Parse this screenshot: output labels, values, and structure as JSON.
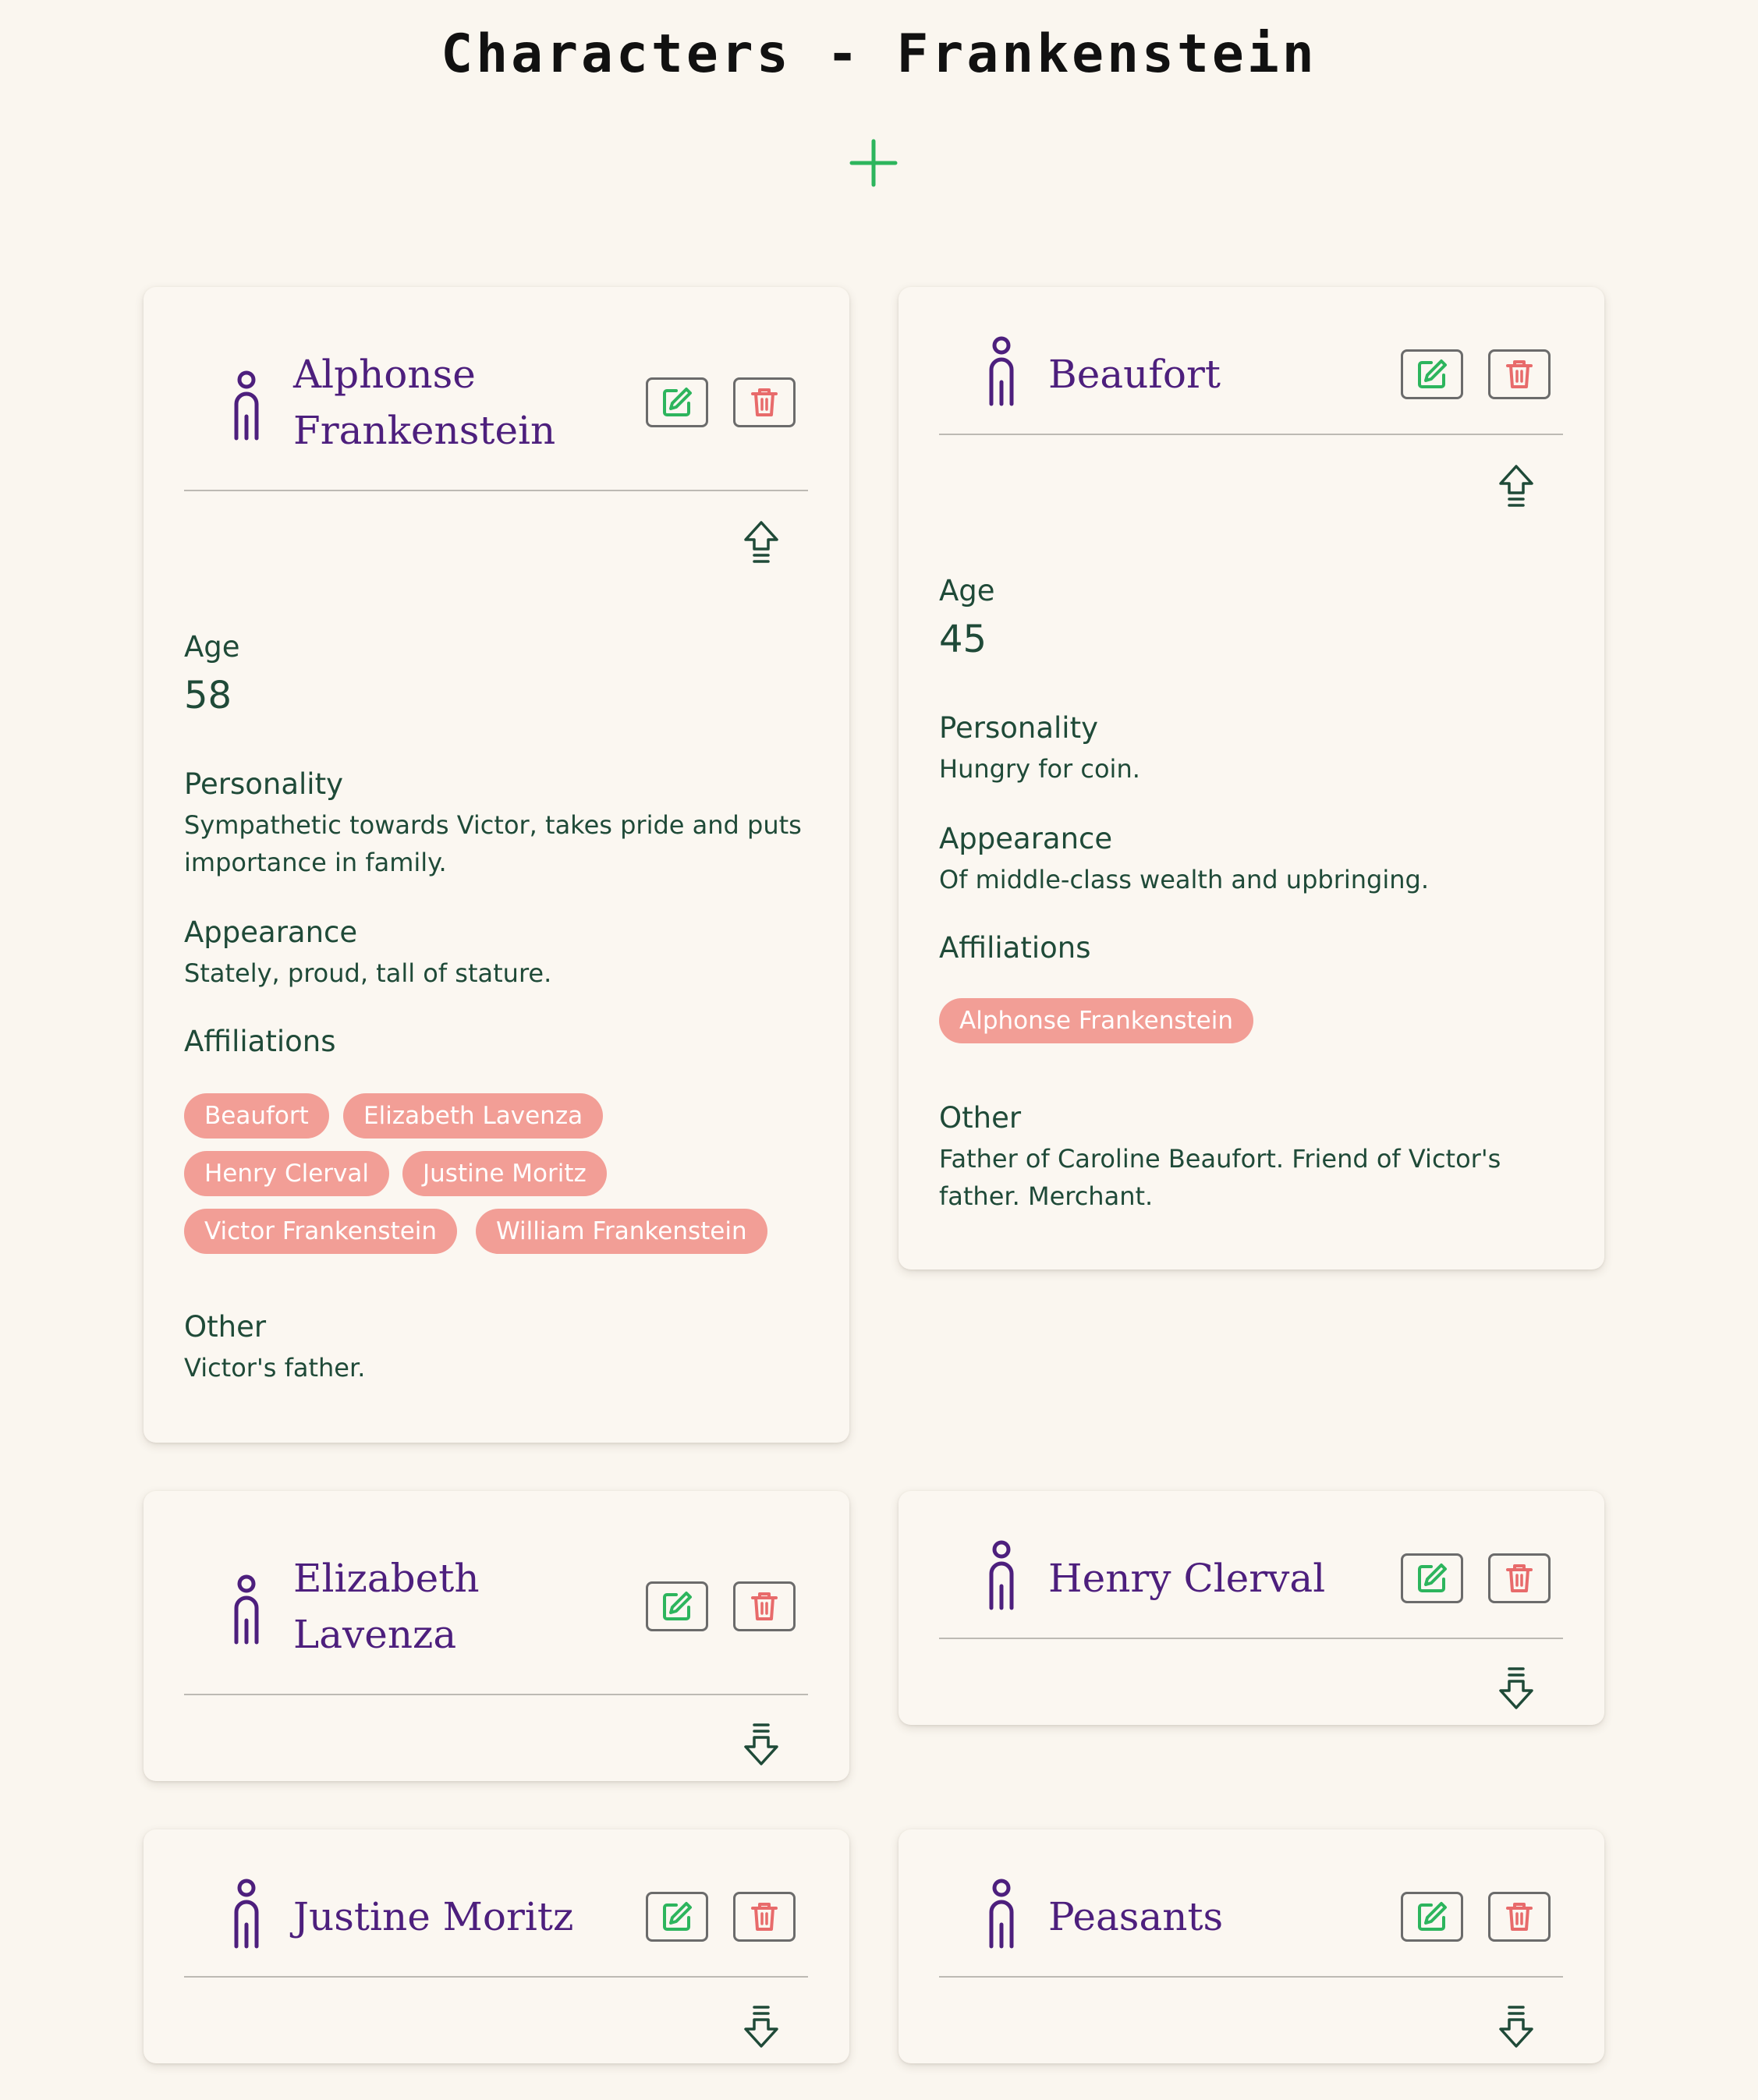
{
  "page": {
    "title": "Characters - Frankenstein"
  },
  "icons": {
    "add": "plus-icon",
    "character": "person-icon",
    "edit": "pencil-square-icon",
    "delete": "trash-icon",
    "collapse": "arrow-up-icon",
    "expand": "arrow-down-icon"
  },
  "colors": {
    "background": "#faf6ef",
    "card": "#fbf7f1",
    "accent_green": "#2db55d",
    "delete_red": "#e86b6b",
    "name_purple": "#4d1f7d",
    "text_green": "#1f4a38",
    "tag_pink": "#f29e96"
  },
  "labels": {
    "age": "Age",
    "personality": "Personality",
    "appearance": "Appearance",
    "affiliations": "Affiliations",
    "other": "Other"
  },
  "characters": [
    {
      "name_line1": "Alphonse",
      "name_line2": "Frankenstein",
      "expanded": true,
      "age": "58",
      "personality_line1": "Sympathetic towards Victor, takes pride and puts",
      "personality_line2": "importance in family.",
      "appearance": "Stately, proud, tall of stature.",
      "affiliations": [
        "Beaufort",
        "Elizabeth Lavenza",
        "Henry Clerval",
        "Justine Moritz",
        "Victor Frankenstein",
        "William Frankenstein"
      ],
      "other": "Victor's father."
    },
    {
      "name": "Beaufort",
      "expanded": true,
      "age": "45",
      "personality": "Hungry for coin.",
      "appearance": "Of middle-class wealth and upbringing.",
      "affiliations": [
        "Alphonse Frankenstein"
      ],
      "other_line1": "Father of Caroline Beaufort. Friend of Victor's",
      "other_line2": "father. Merchant."
    },
    {
      "name_line1": "Elizabeth",
      "name_line2": "Lavenza",
      "expanded": false
    },
    {
      "name": "Henry Clerval",
      "expanded": false
    },
    {
      "name": "Justine Moritz",
      "expanded": false
    },
    {
      "name": "Peasants",
      "expanded": false
    }
  ]
}
